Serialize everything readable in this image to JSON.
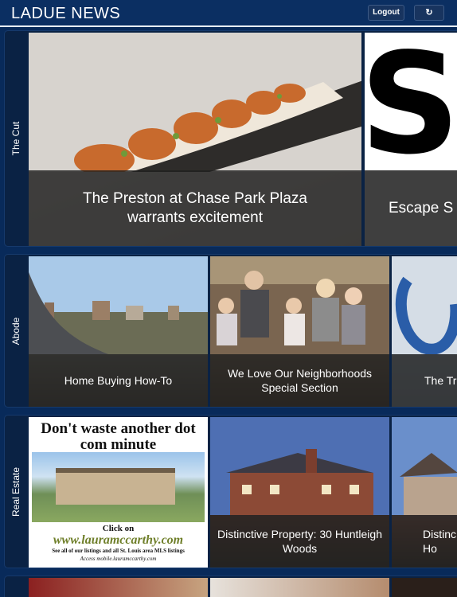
{
  "header": {
    "logo": "LADUE NEWS",
    "logout_label": "Logout",
    "refresh_icon": "↻"
  },
  "sections": [
    {
      "label": "The Cut",
      "cards": [
        {
          "caption": "The Preston at Chase Park Plaza warrants excitement"
        },
        {
          "image_text": "SC",
          "caption": "Escape S"
        }
      ]
    },
    {
      "label": "Abode",
      "cards": [
        {
          "caption": "Home Buying How-To"
        },
        {
          "caption": "We Love Our Neighborhoods Special Section"
        },
        {
          "caption": "The Tr"
        }
      ]
    },
    {
      "label": "Real Estate",
      "cards": [
        {
          "ad": {
            "headline": "Don't waste another dot com minute",
            "click": "Click on",
            "url": "www.lauramccarthy.com",
            "line1": "See all of our listings and all St. Louis area MLS listings",
            "line2": "Access mobile.lauramccarthy.com"
          }
        },
        {
          "caption": "Distinctive Property: 30 Huntleigh Woods"
        },
        {
          "caption": "Distinc Ho"
        }
      ]
    }
  ],
  "colors": {
    "background": "#082a5a",
    "header": "#0b2f62",
    "caption_overlay": "#202020"
  }
}
